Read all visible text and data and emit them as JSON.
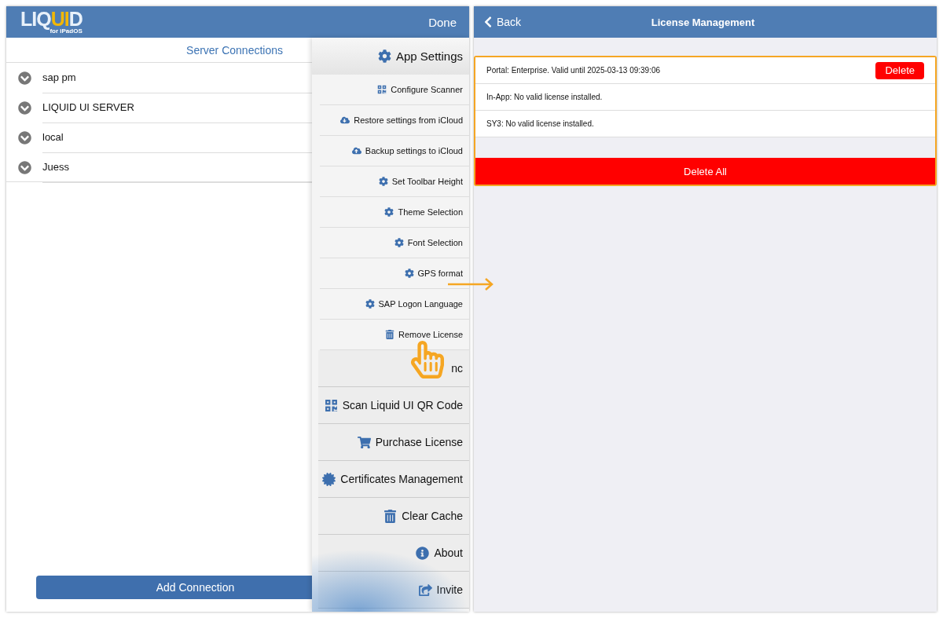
{
  "left_screen": {
    "logo": {
      "prefix": "LIQ",
      "highlight": "UI",
      "suffix": "D",
      "subtitle": "for iPadOS"
    },
    "done": "Done",
    "section_title": "Server Connections",
    "connections": [
      "sap pm",
      "LIQUID UI SERVER",
      "local",
      "Juess"
    ],
    "add_button": "Add Connection",
    "menu": {
      "title": "App Settings",
      "small_items": [
        {
          "kind": "qr",
          "label": "Configure Scanner"
        },
        {
          "kind": "cloud-down",
          "label": "Restore settings from iCloud"
        },
        {
          "kind": "cloud-up",
          "label": "Backup settings to iCloud"
        },
        {
          "kind": "gear",
          "label": "Set Toolbar Height"
        },
        {
          "kind": "gear",
          "label": "Theme Selection"
        },
        {
          "kind": "gear",
          "label": "Font Selection"
        },
        {
          "kind": "gear",
          "label": "GPS format"
        },
        {
          "kind": "gear",
          "label": "SAP Logon Language"
        },
        {
          "kind": "trash",
          "label": "Remove License"
        }
      ],
      "large_items": [
        {
          "kind": "plain",
          "label": "nc"
        },
        {
          "kind": "qr",
          "label": "Scan Liquid UI QR Code"
        },
        {
          "kind": "cart",
          "label": "Purchase License"
        },
        {
          "kind": "badge",
          "label": "Certificates Management"
        },
        {
          "kind": "trash",
          "label": "Clear Cache"
        },
        {
          "kind": "info",
          "label": "About"
        },
        {
          "kind": "share",
          "label": "Invite"
        }
      ]
    }
  },
  "right_screen": {
    "back": "Back",
    "title": "License Management",
    "licenses": [
      {
        "text": "Portal: Enterprise. Valid until 2025-03-13 09:39:06",
        "button": "Delete"
      },
      {
        "text": "In-App: No valid license installed."
      },
      {
        "text": "SY3: No valid license installed."
      }
    ],
    "delete_all": "Delete All"
  }
}
